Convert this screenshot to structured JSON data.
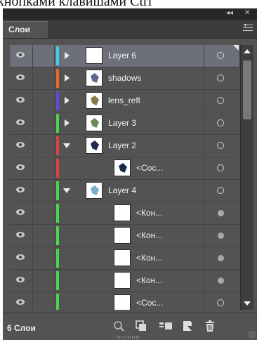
{
  "window": {
    "caption_fragment": "кнопками клавишами Ctrl",
    "collapse_icon": "double-chevron-left-icon",
    "close_icon": "close-icon"
  },
  "panel": {
    "tab_label": "Слои",
    "menu_icon": "panel-menu-icon",
    "layer_count": "6 Слои"
  },
  "layers": [
    {
      "name": "Layer 6",
      "indent": 0,
      "expander": "collapsed",
      "color": "#3fd0f0",
      "target": "ring",
      "selected": true
    },
    {
      "name": "shadows",
      "indent": 0,
      "expander": "collapsed",
      "color": "#ea6a2a",
      "target": "ring",
      "selected": false
    },
    {
      "name": "lens_refl",
      "indent": 0,
      "expander": "collapsed",
      "color": "#5a4ae8",
      "target": "ring",
      "selected": false
    },
    {
      "name": "Layer 3",
      "indent": 0,
      "expander": "collapsed",
      "color": "#47d84a",
      "target": "ring",
      "selected": false
    },
    {
      "name": "Layer 2",
      "indent": 0,
      "expander": "expanded",
      "color": "#e04040",
      "target": "ring",
      "selected": false
    },
    {
      "name": "<Сос...",
      "indent": 1,
      "expander": "none",
      "color": "#e04040",
      "target": "ring",
      "selected": false
    },
    {
      "name": "Layer 4",
      "indent": 0,
      "expander": "expanded",
      "color": "#47d84a",
      "target": "ring",
      "selected": false
    },
    {
      "name": "<Кон...",
      "indent": 1,
      "expander": "none",
      "color": "#47d84a",
      "target": "dot",
      "selected": false
    },
    {
      "name": "<Кон...",
      "indent": 1,
      "expander": "none",
      "color": "#47d84a",
      "target": "dot",
      "selected": false
    },
    {
      "name": "<Кон...",
      "indent": 1,
      "expander": "none",
      "color": "#47d84a",
      "target": "dot",
      "selected": false
    },
    {
      "name": "<Кон...",
      "indent": 1,
      "expander": "none",
      "color": "#47d84a",
      "target": "dot",
      "selected": false
    },
    {
      "name": "<Сос...",
      "indent": 1,
      "expander": "none",
      "color": "#47d84a",
      "target": "ring",
      "selected": false
    }
  ],
  "footer_icons": [
    "locate-object-icon",
    "make-clipping-mask-icon",
    "create-sublayer-icon",
    "create-new-layer-icon",
    "delete-layer-icon"
  ]
}
